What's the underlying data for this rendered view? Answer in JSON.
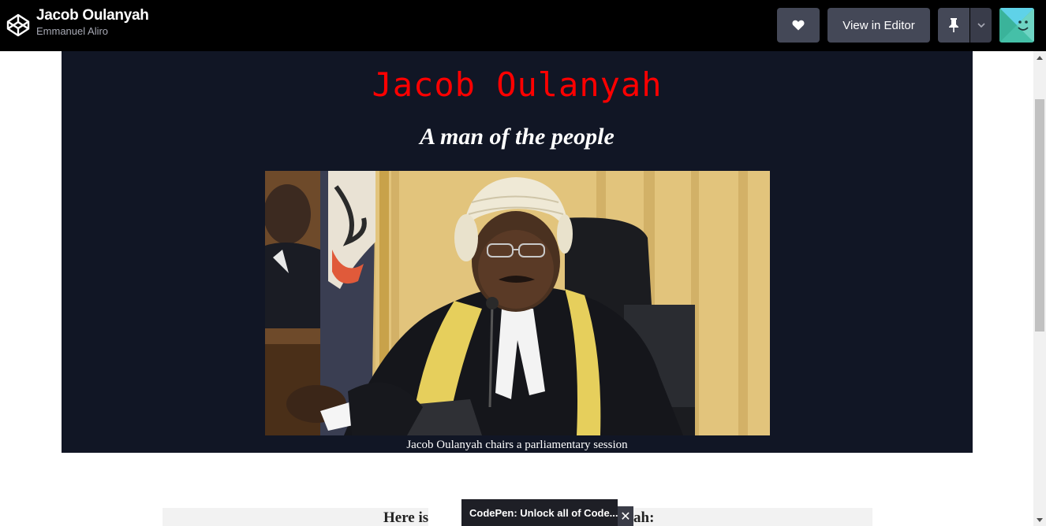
{
  "header": {
    "pen_title": "Jacob Oulanyah",
    "author": "Emmanuel Aliro",
    "view_in_editor_label": "View in Editor",
    "logo_icon": "codepen-logo-icon",
    "like_icon": "heart-icon",
    "pin_icon": "pin-icon",
    "menu_icon": "chevron-down-icon",
    "avatar_icon": "user-avatar"
  },
  "page": {
    "title": "Jacob Oulanyah",
    "tagline": "A man of the people",
    "image_caption": "Jacob Oulanyah chairs a parliamentary session",
    "intro_text_left": "Here is",
    "intro_text_right": "ah:"
  },
  "toast": {
    "text": "CodePen: Unlock all of Code...",
    "close_symbol": "✕"
  },
  "colors": {
    "title_red": "#ff0000",
    "hero_bg": "#111625",
    "header_bg": "#000000",
    "button_bg": "#444857"
  }
}
